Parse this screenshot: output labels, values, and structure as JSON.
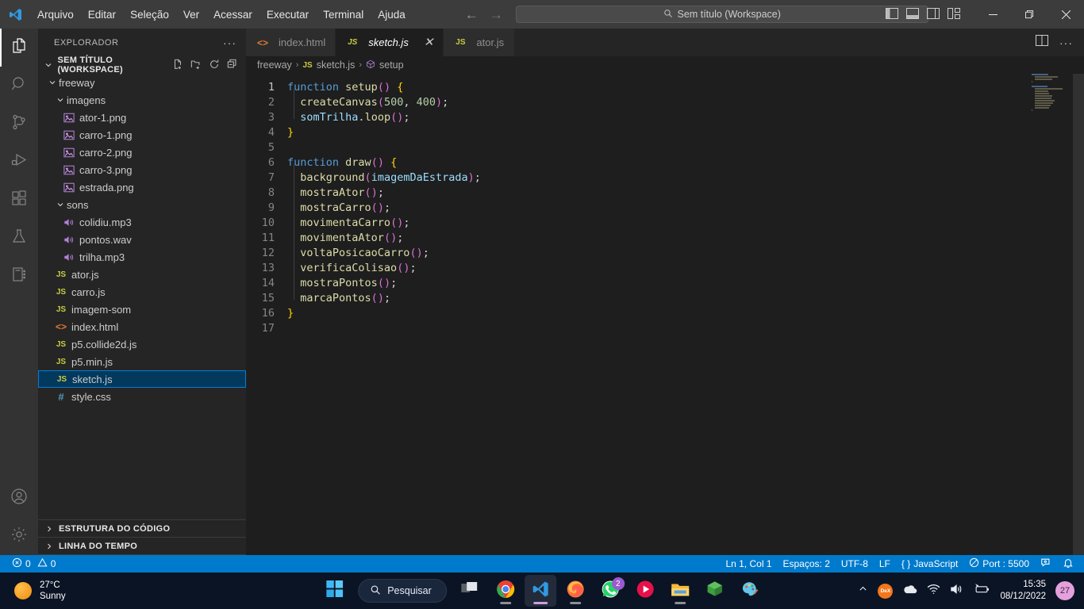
{
  "titlebar": {
    "logo_icon": "vscode-logo-icon",
    "menus": [
      "Arquivo",
      "Editar",
      "Seleção",
      "Ver",
      "Acessar",
      "Executar",
      "Terminal",
      "Ajuda"
    ],
    "back_icon": "arrow-left-icon",
    "forward_icon": "arrow-right-icon",
    "quick_search": {
      "icon": "search-icon",
      "value": "Sem título (Workspace)"
    },
    "layout_icons": [
      "toggle-primary-sidebar-icon",
      "toggle-panel-icon",
      "toggle-secondary-sidebar-icon",
      "customize-layout-icon"
    ],
    "window_controls": [
      "minimize-icon",
      "maximize-icon",
      "close-icon"
    ]
  },
  "activitybar": {
    "items": [
      {
        "name": "explorer",
        "icon": "files-icon",
        "active": true
      },
      {
        "name": "search",
        "icon": "search-icon",
        "active": false
      },
      {
        "name": "source-control",
        "icon": "source-control-icon",
        "active": false
      },
      {
        "name": "run-debug",
        "icon": "run-and-debug-icon",
        "active": false
      },
      {
        "name": "extensions",
        "icon": "extensions-icon",
        "active": false
      },
      {
        "name": "testing",
        "icon": "beaker-icon",
        "active": false
      },
      {
        "name": "notebook",
        "icon": "notebook-icon",
        "active": false
      }
    ],
    "bottom": [
      {
        "name": "accounts",
        "icon": "account-icon"
      },
      {
        "name": "manage",
        "icon": "gear-icon"
      }
    ]
  },
  "sidebar": {
    "title": "EXPLORADOR",
    "more_icon": "ellipsis-icon",
    "workspace": {
      "label": "SEM TÍTULO (WORKSPACE)",
      "expanded": true,
      "actions": [
        "new-file-icon",
        "new-folder-icon",
        "refresh-icon",
        "collapse-all-icon"
      ]
    },
    "tree": [
      {
        "label": "freeway",
        "type": "folder",
        "depth": 1,
        "expanded": true,
        "icon": "chevron-down-icon"
      },
      {
        "label": "imagens",
        "type": "folder",
        "depth": 2,
        "expanded": true,
        "icon": "chevron-down-icon"
      },
      {
        "label": "ator-1.png",
        "type": "image",
        "depth": 3,
        "icon": "image-file-icon"
      },
      {
        "label": "carro-1.png",
        "type": "image",
        "depth": 3,
        "icon": "image-file-icon"
      },
      {
        "label": "carro-2.png",
        "type": "image",
        "depth": 3,
        "icon": "image-file-icon"
      },
      {
        "label": "carro-3.png",
        "type": "image",
        "depth": 3,
        "icon": "image-file-icon"
      },
      {
        "label": "estrada.png",
        "type": "image",
        "depth": 3,
        "icon": "image-file-icon"
      },
      {
        "label": "sons",
        "type": "folder",
        "depth": 2,
        "expanded": true,
        "icon": "chevron-down-icon"
      },
      {
        "label": "colidiu.mp3",
        "type": "audio",
        "depth": 3,
        "icon": "audio-file-icon"
      },
      {
        "label": "pontos.wav",
        "type": "audio",
        "depth": 3,
        "icon": "audio-file-icon"
      },
      {
        "label": "trilha.mp3",
        "type": "audio",
        "depth": 3,
        "icon": "audio-file-icon"
      },
      {
        "label": "ator.js",
        "type": "js",
        "depth": 2,
        "icon": "js-file-icon"
      },
      {
        "label": "carro.js",
        "type": "js",
        "depth": 2,
        "icon": "js-file-icon"
      },
      {
        "label": "imagem-som",
        "type": "js",
        "depth": 2,
        "icon": "js-file-icon"
      },
      {
        "label": "index.html",
        "type": "html",
        "depth": 2,
        "icon": "html-file-icon"
      },
      {
        "label": "p5.collide2d.js",
        "type": "js",
        "depth": 2,
        "icon": "js-file-icon"
      },
      {
        "label": "p5.min.js",
        "type": "js",
        "depth": 2,
        "icon": "js-file-icon"
      },
      {
        "label": "sketch.js",
        "type": "js",
        "depth": 2,
        "icon": "js-file-icon",
        "selected": true
      },
      {
        "label": "style.css",
        "type": "css",
        "depth": 2,
        "icon": "css-file-icon"
      }
    ],
    "bottom_sections": [
      {
        "label": "ESTRUTURA DO CÓDIGO",
        "expanded": false,
        "icon": "chevron-right-icon"
      },
      {
        "label": "LINHA DO TEMPO",
        "expanded": false,
        "icon": "chevron-right-icon"
      }
    ]
  },
  "editor": {
    "tabs": [
      {
        "label": "index.html",
        "icon": "html-file-icon",
        "active": false,
        "closable": false
      },
      {
        "label": "sketch.js",
        "icon": "js-file-icon",
        "active": true,
        "closable": true,
        "close_icon": "close-icon"
      },
      {
        "label": "ator.js",
        "icon": "js-file-icon",
        "active": false,
        "closable": false
      }
    ],
    "tab_actions": [
      "split-editor-icon",
      "more-actions-icon"
    ],
    "breadcrumb": [
      {
        "label": "freeway",
        "icon": ""
      },
      {
        "label": "sketch.js",
        "icon": "js-file-icon"
      },
      {
        "label": "setup",
        "icon": "symbol-function-icon"
      }
    ],
    "breadcrumb_separator": "›",
    "lines": [
      {
        "n": 1,
        "tokens": [
          {
            "t": "function",
            "c": "kw"
          },
          {
            "t": " ",
            "c": "punc"
          },
          {
            "t": "setup",
            "c": "fn"
          },
          {
            "t": "(",
            "c": "par2"
          },
          {
            "t": ")",
            "c": "par2"
          },
          {
            "t": " ",
            "c": "punc"
          },
          {
            "t": "{",
            "c": "par1"
          }
        ]
      },
      {
        "n": 2,
        "tokens": [
          {
            "t": "  ",
            "c": "punc"
          },
          {
            "t": "createCanvas",
            "c": "fn"
          },
          {
            "t": "(",
            "c": "par2"
          },
          {
            "t": "500",
            "c": "num"
          },
          {
            "t": ", ",
            "c": "punc"
          },
          {
            "t": "400",
            "c": "num"
          },
          {
            "t": ")",
            "c": "par2"
          },
          {
            "t": ";",
            "c": "punc"
          }
        ]
      },
      {
        "n": 3,
        "tokens": [
          {
            "t": "  ",
            "c": "punc"
          },
          {
            "t": "somTrilha",
            "c": "var"
          },
          {
            "t": ".",
            "c": "punc"
          },
          {
            "t": "loop",
            "c": "fn"
          },
          {
            "t": "(",
            "c": "par2"
          },
          {
            "t": ")",
            "c": "par2"
          },
          {
            "t": ";",
            "c": "punc"
          }
        ]
      },
      {
        "n": 4,
        "tokens": [
          {
            "t": "}",
            "c": "par1"
          }
        ]
      },
      {
        "n": 5,
        "tokens": []
      },
      {
        "n": 6,
        "tokens": [
          {
            "t": "function",
            "c": "kw"
          },
          {
            "t": " ",
            "c": "punc"
          },
          {
            "t": "draw",
            "c": "fn"
          },
          {
            "t": "(",
            "c": "par2"
          },
          {
            "t": ")",
            "c": "par2"
          },
          {
            "t": " ",
            "c": "punc"
          },
          {
            "t": "{",
            "c": "par1"
          }
        ]
      },
      {
        "n": 7,
        "tokens": [
          {
            "t": "  ",
            "c": "punc"
          },
          {
            "t": "background",
            "c": "fn"
          },
          {
            "t": "(",
            "c": "par2"
          },
          {
            "t": "imagemDaEstrada",
            "c": "var"
          },
          {
            "t": ")",
            "c": "par2"
          },
          {
            "t": ";",
            "c": "punc"
          }
        ]
      },
      {
        "n": 8,
        "tokens": [
          {
            "t": "  ",
            "c": "punc"
          },
          {
            "t": "mostraAtor",
            "c": "fn"
          },
          {
            "t": "(",
            "c": "par2"
          },
          {
            "t": ")",
            "c": "par2"
          },
          {
            "t": ";",
            "c": "punc"
          }
        ]
      },
      {
        "n": 9,
        "tokens": [
          {
            "t": "  ",
            "c": "punc"
          },
          {
            "t": "mostraCarro",
            "c": "fn"
          },
          {
            "t": "(",
            "c": "par2"
          },
          {
            "t": ")",
            "c": "par2"
          },
          {
            "t": ";",
            "c": "punc"
          }
        ]
      },
      {
        "n": 10,
        "tokens": [
          {
            "t": "  ",
            "c": "punc"
          },
          {
            "t": "movimentaCarro",
            "c": "fn"
          },
          {
            "t": "(",
            "c": "par2"
          },
          {
            "t": ")",
            "c": "par2"
          },
          {
            "t": ";",
            "c": "punc"
          }
        ]
      },
      {
        "n": 11,
        "tokens": [
          {
            "t": "  ",
            "c": "punc"
          },
          {
            "t": "movimentaAtor",
            "c": "fn"
          },
          {
            "t": "(",
            "c": "par2"
          },
          {
            "t": ")",
            "c": "par2"
          },
          {
            "t": ";",
            "c": "punc"
          }
        ]
      },
      {
        "n": 12,
        "tokens": [
          {
            "t": "  ",
            "c": "punc"
          },
          {
            "t": "voltaPosicaoCarro",
            "c": "fn"
          },
          {
            "t": "(",
            "c": "par2"
          },
          {
            "t": ")",
            "c": "par2"
          },
          {
            "t": ";",
            "c": "punc"
          }
        ]
      },
      {
        "n": 13,
        "tokens": [
          {
            "t": "  ",
            "c": "punc"
          },
          {
            "t": "verificaColisao",
            "c": "fn"
          },
          {
            "t": "(",
            "c": "par2"
          },
          {
            "t": ")",
            "c": "par2"
          },
          {
            "t": ";",
            "c": "punc"
          }
        ]
      },
      {
        "n": 14,
        "tokens": [
          {
            "t": "  ",
            "c": "punc"
          },
          {
            "t": "mostraPontos",
            "c": "fn"
          },
          {
            "t": "(",
            "c": "par2"
          },
          {
            "t": ")",
            "c": "par2"
          },
          {
            "t": ";",
            "c": "punc"
          }
        ]
      },
      {
        "n": 15,
        "tokens": [
          {
            "t": "  ",
            "c": "punc"
          },
          {
            "t": "marcaPontos",
            "c": "fn"
          },
          {
            "t": "(",
            "c": "par2"
          },
          {
            "t": ")",
            "c": "par2"
          },
          {
            "t": ";",
            "c": "punc"
          }
        ]
      },
      {
        "n": 16,
        "tokens": [
          {
            "t": "}",
            "c": "par1"
          }
        ]
      },
      {
        "n": 17,
        "tokens": []
      }
    ]
  },
  "statusbar": {
    "errors": {
      "icon": "error-icon",
      "count": "0"
    },
    "warnings": {
      "icon": "warning-icon",
      "count": "0"
    },
    "right": [
      {
        "name": "cursor-position",
        "label": "Ln 1, Col 1"
      },
      {
        "name": "indentation",
        "label": "Espaços: 2"
      },
      {
        "name": "encoding",
        "label": "UTF-8"
      },
      {
        "name": "eol",
        "label": "LF"
      },
      {
        "name": "language-mode",
        "label": "JavaScript",
        "icon": "braces-icon"
      },
      {
        "name": "live-server-port",
        "label": "Port : 5500",
        "icon": "broadcast-icon"
      },
      {
        "name": "feedback",
        "label": "",
        "icon": "feedback-icon"
      },
      {
        "name": "notifications",
        "label": "",
        "icon": "bell-icon"
      }
    ]
  },
  "taskbar": {
    "weather": {
      "temp": "27°C",
      "condition": "Sunny",
      "icon": "sun-icon"
    },
    "start_icon": "windows-start-icon",
    "search": {
      "placeholder": "Pesquisar",
      "icon": "search-icon"
    },
    "apps": [
      {
        "name": "task-view",
        "icon": "task-view-icon",
        "running": false,
        "active": false
      },
      {
        "name": "chrome",
        "icon": "chrome-icon",
        "running": true,
        "active": false
      },
      {
        "name": "vscode",
        "icon": "vscode-icon",
        "running": true,
        "active": true
      },
      {
        "name": "firefox",
        "icon": "firefox-icon",
        "running": true,
        "active": false
      },
      {
        "name": "whatsapp",
        "icon": "whatsapp-icon",
        "running": false,
        "active": false,
        "badge": "2"
      },
      {
        "name": "media-player",
        "icon": "media-player-icon",
        "running": false,
        "active": false
      },
      {
        "name": "file-explorer",
        "icon": "file-explorer-icon",
        "running": true,
        "active": false
      },
      {
        "name": "green-cube-app",
        "icon": "green-cube-icon",
        "running": false,
        "active": false
      },
      {
        "name": "paint",
        "icon": "paint-icon",
        "running": false,
        "active": false
      }
    ],
    "tray": {
      "overflow_icon": "chevron-up-icon",
      "dex_label": "DeX",
      "icons": [
        "onedrive-icon",
        "wifi-icon",
        "volume-icon",
        "battery-icon"
      ],
      "time": "15:35",
      "date": "08/12/2022",
      "badge": "27"
    }
  },
  "colors": {
    "accent": "#007acc",
    "selection": "#04395e",
    "selection_border": "#007fd4",
    "editor_bg": "#1e1e1e",
    "sidebar_bg": "#252526",
    "titlebar_bg": "#3c3c3c",
    "taskbar_bg": "#0b1424"
  }
}
